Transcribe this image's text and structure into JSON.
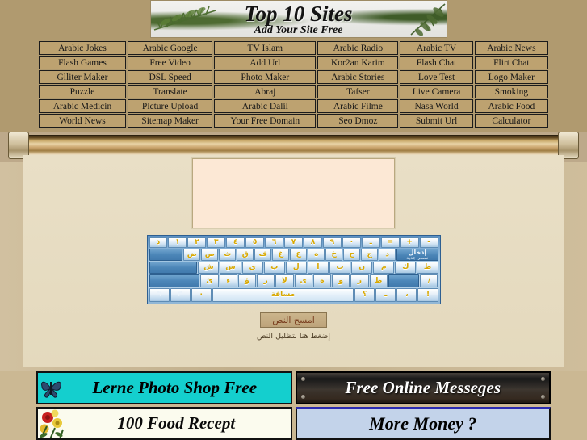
{
  "header": {
    "title": "Top 10 Sites",
    "subtitle": "Add Your Site Free"
  },
  "links": {
    "rows": [
      [
        "Arabic Jokes",
        "Arabic Google",
        "TV Islam",
        "Arabic Radio",
        "Arabic TV",
        "Arabic News"
      ],
      [
        "Flash Games",
        "Free Video",
        "Add Url",
        "Kor2an Karim",
        "Flash Chat",
        "Flirt Chat"
      ],
      [
        "Glliter Maker",
        "DSL Speed",
        "Photo Maker",
        "Arabic Stories",
        "Love Test",
        "Logo Maker"
      ],
      [
        "Puzzle",
        "Translate",
        "Abraj",
        "Tafser",
        "Live Camera",
        "Smoking"
      ],
      [
        "Arabic Medicin",
        "Picture Upload",
        "Arabic Dalil",
        "Arabic Filme",
        "Nasa World",
        "Arabic Food"
      ],
      [
        "World News",
        "Sitemap Maker",
        "Your Free Domain",
        "Seo Dmoz",
        "Submit Url",
        "Calculator"
      ]
    ]
  },
  "editor": {
    "textarea_value": "",
    "textarea_placeholder": ""
  },
  "keyboard": {
    "rows": [
      [
        {
          "label": "ذ",
          "type": "key"
        },
        {
          "label": "١",
          "type": "key"
        },
        {
          "label": "٢",
          "type": "key"
        },
        {
          "label": "٣",
          "type": "key"
        },
        {
          "label": "٤",
          "type": "key"
        },
        {
          "label": "٥",
          "type": "key"
        },
        {
          "label": "٦",
          "type": "key"
        },
        {
          "label": "٧",
          "type": "key"
        },
        {
          "label": "٨",
          "type": "key"
        },
        {
          "label": "٩",
          "type": "key"
        },
        {
          "label": "٠",
          "type": "key"
        },
        {
          "label": "ـ",
          "type": "key"
        },
        {
          "label": "=",
          "type": "key"
        },
        {
          "label": "+",
          "type": "key"
        },
        {
          "label": "-",
          "type": "key"
        }
      ],
      [
        {
          "label": "",
          "type": "blank",
          "size": "k-tab"
        },
        {
          "label": "ض",
          "type": "key"
        },
        {
          "label": "ص",
          "type": "key"
        },
        {
          "label": "ث",
          "type": "key"
        },
        {
          "label": "ق",
          "type": "key"
        },
        {
          "label": "ف",
          "type": "key"
        },
        {
          "label": "غ",
          "type": "key"
        },
        {
          "label": "ع",
          "type": "key"
        },
        {
          "label": "ه",
          "type": "key"
        },
        {
          "label": "خ",
          "type": "key"
        },
        {
          "label": "ح",
          "type": "key"
        },
        {
          "label": "ج",
          "type": "key"
        },
        {
          "label": "د",
          "type": "key"
        },
        {
          "label": "إدخال",
          "sub": "سطر جديد",
          "type": "enter",
          "size": "k-enter"
        }
      ],
      [
        {
          "label": "",
          "type": "blank",
          "size": "k-caps"
        },
        {
          "label": "ش",
          "type": "key"
        },
        {
          "label": "س",
          "type": "key"
        },
        {
          "label": "ي",
          "type": "key"
        },
        {
          "label": "ب",
          "type": "key"
        },
        {
          "label": "ل",
          "type": "key"
        },
        {
          "label": "ا",
          "type": "key"
        },
        {
          "label": "ت",
          "type": "key"
        },
        {
          "label": "ن",
          "type": "key"
        },
        {
          "label": "م",
          "type": "key"
        },
        {
          "label": "ك",
          "type": "key"
        },
        {
          "label": "ط",
          "type": "key"
        }
      ],
      [
        {
          "label": "",
          "type": "blank",
          "size": "k-shift"
        },
        {
          "label": "ئ",
          "type": "key"
        },
        {
          "label": "ء",
          "type": "key"
        },
        {
          "label": "ؤ",
          "type": "key"
        },
        {
          "label": "ر",
          "type": "key"
        },
        {
          "label": "لا",
          "type": "key"
        },
        {
          "label": "ى",
          "type": "key"
        },
        {
          "label": "ة",
          "type": "key"
        },
        {
          "label": "و",
          "type": "key"
        },
        {
          "label": "ز",
          "type": "key"
        },
        {
          "label": "ظ",
          "type": "key"
        },
        {
          "label": "",
          "type": "blank",
          "size": "k-shift2"
        },
        {
          "label": "/",
          "type": "key"
        }
      ],
      [
        {
          "label": "↰",
          "type": "arrow"
        },
        {
          "label": "↱",
          "type": "arrow"
        },
        {
          "label": "٠",
          "type": "key"
        },
        {
          "label": "مسافة",
          "type": "space",
          "size": "k-space"
        },
        {
          "label": "؟",
          "type": "key"
        },
        {
          "label": "ـ",
          "type": "key"
        },
        {
          "label": "،",
          "type": "key"
        },
        {
          "label": "!",
          "type": "key"
        }
      ]
    ]
  },
  "actions": {
    "clear_button": "امسح النص",
    "hint": "إضغط هنا لتظليل النص"
  },
  "ads": {
    "left": [
      {
        "text": "Lerne Photo Shop Free",
        "style": "ad-photoshop"
      },
      {
        "text": "100 Food Recept",
        "style": "ad-food"
      }
    ],
    "right": [
      {
        "text": "Free Online Messeges",
        "style": "ad-msg"
      },
      {
        "text": "More Money ?",
        "style": "ad-money"
      }
    ]
  },
  "colors": {
    "page_background": "#cbb893",
    "header_background": "#b09a6f",
    "link_cell": "#bda270",
    "textarea": "#fce8d5",
    "keyboard_frame": "#5c91c4",
    "key_text": "#d8a800",
    "button_text": "#7a3f20"
  }
}
